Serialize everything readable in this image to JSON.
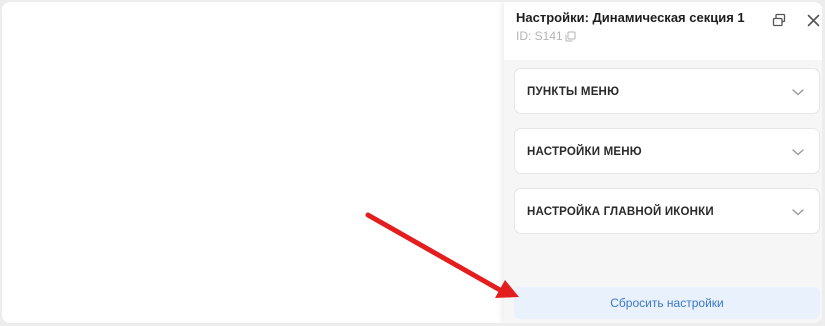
{
  "panel": {
    "title": "Настройки: Динамическая секция 1",
    "id_text": "ID: S141",
    "sections": [
      {
        "label": "ПУНКТЫ МЕНЮ"
      },
      {
        "label": "НАСТРОЙКИ МЕНЮ"
      },
      {
        "label": "НАСТРОЙКА ГЛАВНОЙ ИКОНКИ"
      }
    ],
    "reset_label": "Сбросить настройки"
  },
  "icons": {
    "copy": "copy-icon",
    "popout": "popout-icon",
    "close": "close-icon",
    "chevron": "chevron-down-icon",
    "annotation": "red-arrow-annotation"
  },
  "colors": {
    "accent": "#3a78c9",
    "reset_bg": "#e8f1fc",
    "annotation": "#e41e1e"
  }
}
